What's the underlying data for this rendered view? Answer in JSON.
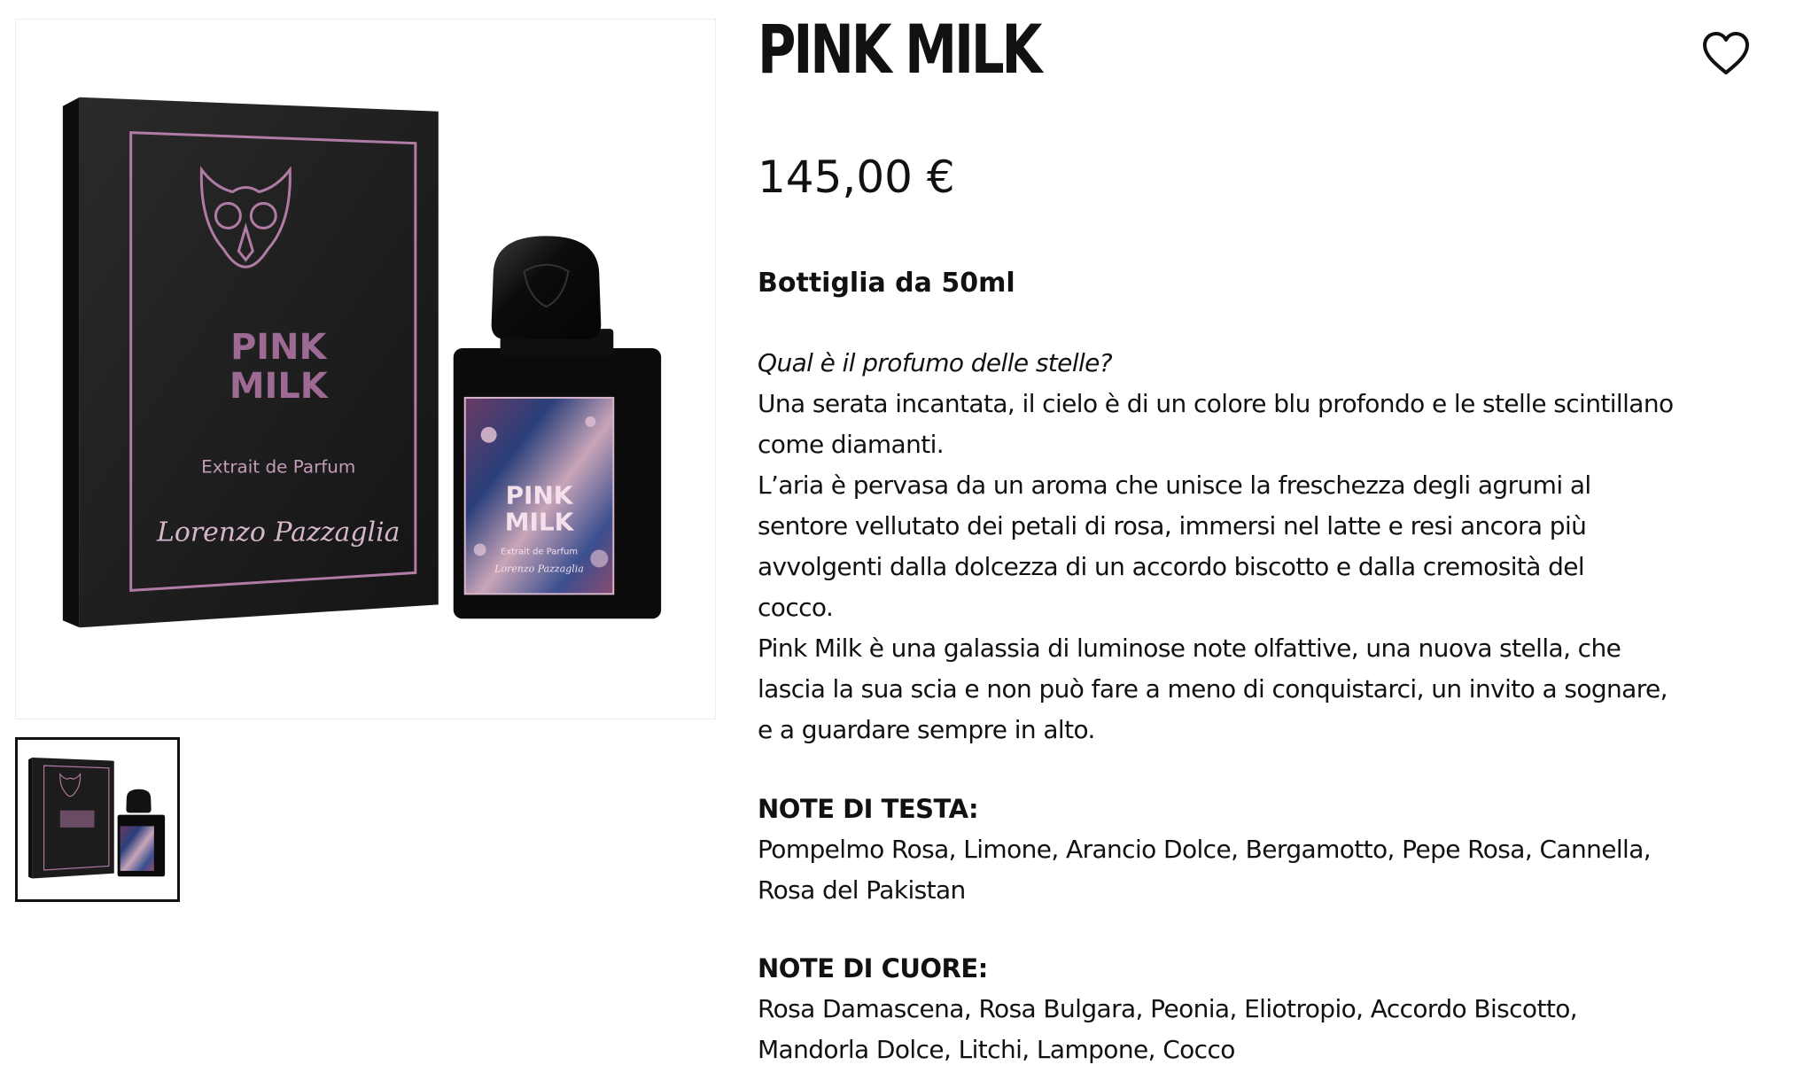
{
  "product": {
    "title": "PINK MILK",
    "price": "145,00 €",
    "size": "Bottiglia da 50ml",
    "description": {
      "question": "Qual è il profumo delle stelle?",
      "lines": [
        "Una serata incantata, il cielo è di un colore blu profondo e le stelle scintillano",
        "come diamanti.",
        "L’aria è pervasa da un aroma che unisce la freschezza degli agrumi al",
        "sentore vellutato dei petali di rosa, immersi nel latte e resi ancora più",
        "avvolgenti dalla dolcezza di un accordo biscotto e dalla cremosità del",
        "cocco.",
        "Pink Milk è una galassia di luminose note olfattive, una nuova stella, che",
        "lascia la sua scia e non può fare a meno di conquistarci, un invito a sognare,",
        "e a guardare sempre in alto."
      ]
    },
    "notes": {
      "top": {
        "label": "NOTE DI TESTA:",
        "lines": [
          "Pompelmo Rosa, Limone, Arancio Dolce, Bergamotto, Pepe Rosa, Cannella,",
          "Rosa del Pakistan"
        ]
      },
      "heart": {
        "label": "NOTE DI CUORE:",
        "lines": [
          "Rosa Damascena, Rosa Bulgara, Peonia, Eliotropio, Accordo Biscotto,",
          "Mandorla Dolce, Litchi, Lampone, Cocco"
        ]
      }
    }
  },
  "image": {
    "box_title_line1": "PINK",
    "box_title_line2": "MILK",
    "box_subtitle": "Extrait de Parfum",
    "box_signature": "Lorenzo Pazzaglia",
    "bottle_label_line1": "PINK",
    "bottle_label_line2": "MILK",
    "bottle_label_sub": "Extrait de Parfum",
    "bottle_label_sig": "Lorenzo Pazzaglia"
  },
  "icons": {
    "wishlist": "heart-outline-icon",
    "owl": "owl-emblem-icon"
  },
  "colors": {
    "text": "#111111",
    "box_black": "#1b1b1b",
    "foil_pink": "#b07ba4",
    "thumb_border": "#111111"
  }
}
